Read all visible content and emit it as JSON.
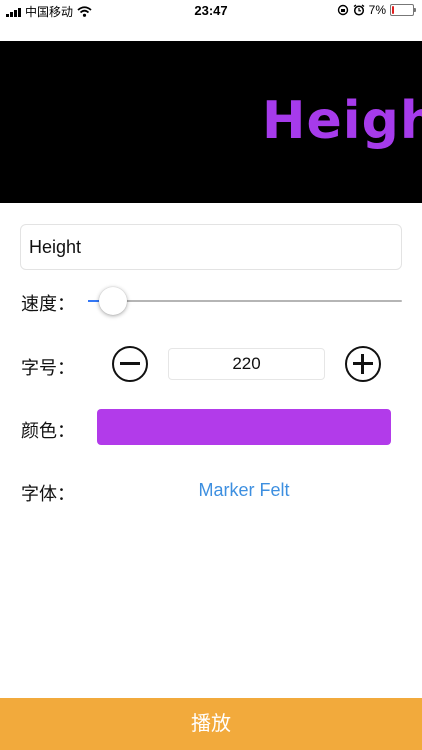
{
  "status_bar": {
    "carrier": "中国移动",
    "time": "23:47",
    "battery_percent": "7%",
    "battery_level": 0.07,
    "icons": [
      "signal-bars-icon",
      "wifi-icon",
      "rotation-lock-icon",
      "alarm-icon",
      "battery-icon"
    ]
  },
  "preview": {
    "text": "Height",
    "background": "#000000",
    "text_color": "#A63BEB"
  },
  "form": {
    "text_value": "Height",
    "speed_label": "速度：",
    "speed_value": 0.04,
    "size_label": "字号：",
    "size_value": "220",
    "decrease_icon": "minus-circle-icon",
    "increase_icon": "plus-circle-icon",
    "color_label": "颜色：",
    "color_value": "#B23BEA",
    "font_label": "字体：",
    "font_name": "Marker Felt",
    "font_link_color": "#3D8FE0"
  },
  "play_button": {
    "label": "播放",
    "background": "#F2AA3C"
  }
}
